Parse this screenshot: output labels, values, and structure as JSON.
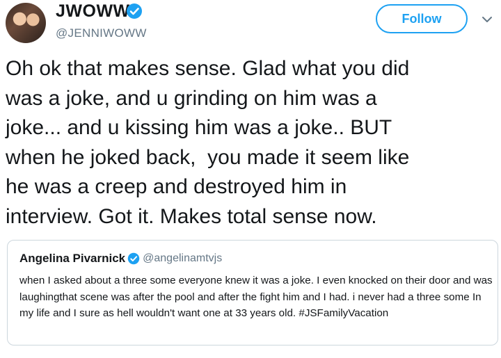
{
  "author": {
    "display_name": "JWOWW",
    "handle": "@JENNIWOWW",
    "verified": true
  },
  "follow_button": {
    "label": "Follow"
  },
  "tweet": {
    "text": "Oh ok that makes sense. Glad what you did\nwas a joke, and u grinding on him was a\njoke... and u kissing him was a joke.. BUT\nwhen he joked back,  you made it seem like\nhe was a creep and destroyed him in\ninterview. Got it. Makes total sense now."
  },
  "quoted_tweet": {
    "display_name": "Angelina Pivarnick",
    "handle": "@angelinamtvjs",
    "verified": true,
    "text": "when I asked about a three some everyone knew it was a joke. I even knocked on their door and was laughingthat scene was after the pool and after the fight him and I had. i never had a three some In my life and I sure as hell wouldn't want one at 33 years old. #JSFamilyVacation"
  },
  "colors": {
    "accent": "#1da1f2",
    "text": "#14171a",
    "secondary_text": "#657786",
    "border": "#ccd6dd"
  },
  "icons": {
    "verified": "verified-badge-icon",
    "menu": "chevron-down-icon"
  }
}
